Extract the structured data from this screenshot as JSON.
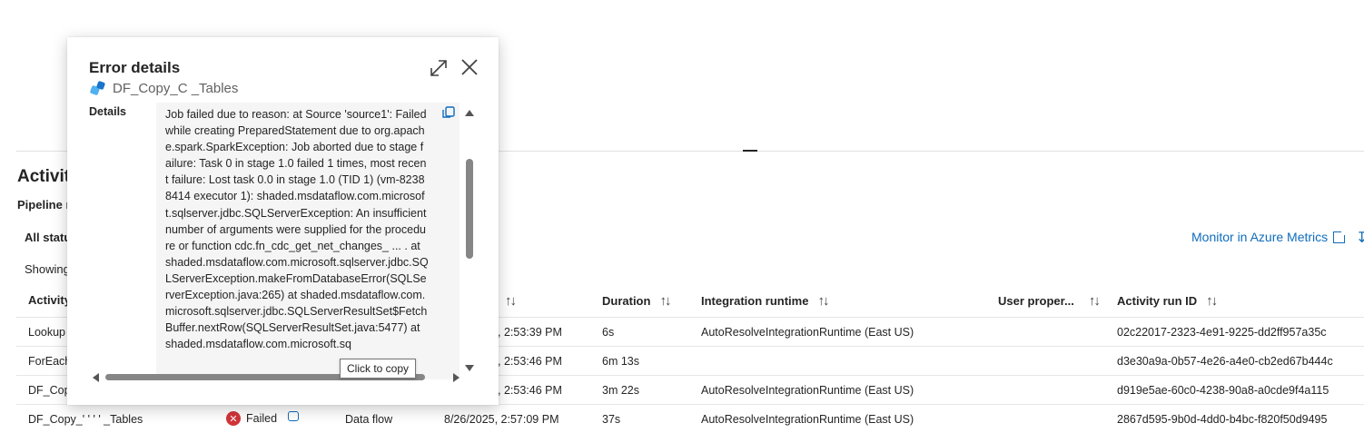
{
  "page": {
    "section_title": "Activity",
    "pipeline_label": "Pipeline r",
    "filter_label": "All statu",
    "showing_label": "Showing",
    "monitor_link": "Monitor in Azure Metrics"
  },
  "table": {
    "headers": {
      "activity": "Activity",
      "duration": "Duration",
      "integration_runtime": "Integration runtime",
      "user_properties": "User proper...",
      "activity_run_id": "Activity run ID"
    },
    "rows": [
      {
        "name": "Lookup",
        "status": "",
        "type": "",
        "start": ", 2:53:39 PM",
        "duration": "6s",
        "runtime": "AutoResolveIntegrationRuntime (East US)",
        "run_id": "02c22017-2323-4e91-9225-dd2ff957a35c"
      },
      {
        "name": "ForEach",
        "status": "",
        "type": "",
        "start": ", 2:53:46 PM",
        "duration": "6m 13s",
        "runtime": "",
        "run_id": "d3e30a9a-0b57-4e26-a4e0-cb2ed67b444c"
      },
      {
        "name": "DF_Cop",
        "status": "",
        "type": "",
        "start": ", 2:53:46 PM",
        "duration": "3m 22s",
        "runtime": "AutoResolveIntegrationRuntime (East US)",
        "run_id": "d919e5ae-60c0-4238-90a8-a0cde9f4a115"
      },
      {
        "name": "DF_Copy_' ' ' '  _Tables",
        "status": "Failed",
        "type": "Data flow",
        "start": "8/26/2025, 2:57:09 PM",
        "duration": "37s",
        "runtime": "AutoResolveIntegrationRuntime (East US)",
        "run_id": "2867d595-9b0d-4dd0-b4bc-f820f50d9495"
      }
    ]
  },
  "modal": {
    "title": "Error details",
    "subtitle": "DF_Copy_C           _Tables",
    "details_label": "Details",
    "details_text": "Job failed due to reason: at Source 'source1': Failed while creating PreparedStatement due to org.apache.spark.SparkException: Job aborted due to stage failure: Task 0 in stage 1.0 failed 1 times, most recent failure: Lost task 0.0 in stage 1.0 (TID 1) (vm-82388414 executor 1): shaded.msdataflow.com.microsoft.sqlserver.jdbc.SQLServerException: An insufficient number of arguments were supplied for the procedure or function cdc.fn_cdc_get_net_changes_ ... . at shaded.msdataflow.com.microsoft.sqlserver.jdbc.SQLServerException.makeFromDatabaseError(SQLServerException.java:265) at shaded.msdataflow.com.microsoft.sqlserver.jdbc.SQLServerResultSet$FetchBuffer.nextRow(SQLServerResultSet.java:5477) at shaded.msdataflow.com.microsoft.sq",
    "tooltip": "Click to copy"
  },
  "colors": {
    "accent": "#0f6cbd",
    "failed": "#d13438"
  },
  "icons": [
    "data-flow-icon",
    "expand-icon",
    "close-icon",
    "copy-icon",
    "external-link-icon",
    "download-icon",
    "failed-icon",
    "chat-icon",
    "sort-icon"
  ]
}
